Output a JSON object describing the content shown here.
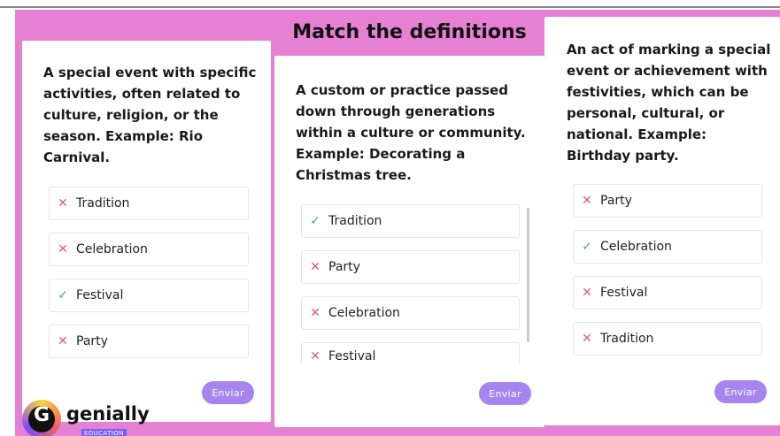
{
  "title": "Match the definitions",
  "colors": {
    "background": "#e680d3",
    "button": "#a685ee",
    "wrong": "#e05a72",
    "correct": "#3ca889"
  },
  "cards": [
    {
      "definition": "A special event with specific activities, often related to culture, religion, or the season. Example: Rio Carnival.",
      "options": [
        {
          "label": "Tradition",
          "status": "wrong"
        },
        {
          "label": "Celebration",
          "status": "wrong"
        },
        {
          "label": "Festival",
          "status": "correct"
        },
        {
          "label": "Party",
          "status": "wrong"
        }
      ],
      "button_label": "Enviar"
    },
    {
      "definition": "A custom or practice passed down through generations within a culture or community. Example: Decorating a Christmas tree.",
      "options": [
        {
          "label": "Tradition",
          "status": "correct"
        },
        {
          "label": "Party",
          "status": "wrong"
        },
        {
          "label": "Celebration",
          "status": "wrong"
        },
        {
          "label": "Festival",
          "status": "wrong"
        }
      ],
      "button_label": "Enviar"
    },
    {
      "definition": "An act of marking a special event or achievement with festivities, which can be personal, cultural, or national. Example: Birthday party.",
      "options": [
        {
          "label": "Party",
          "status": "wrong"
        },
        {
          "label": "Celebration",
          "status": "correct"
        },
        {
          "label": "Festival",
          "status": "wrong"
        },
        {
          "label": "Tradition",
          "status": "wrong"
        }
      ],
      "button_label": "Enviar"
    }
  ],
  "icons": {
    "wrong": "x-icon",
    "correct": "check-icon"
  },
  "logo": {
    "name": "genially",
    "badge": "EDUCATION"
  }
}
